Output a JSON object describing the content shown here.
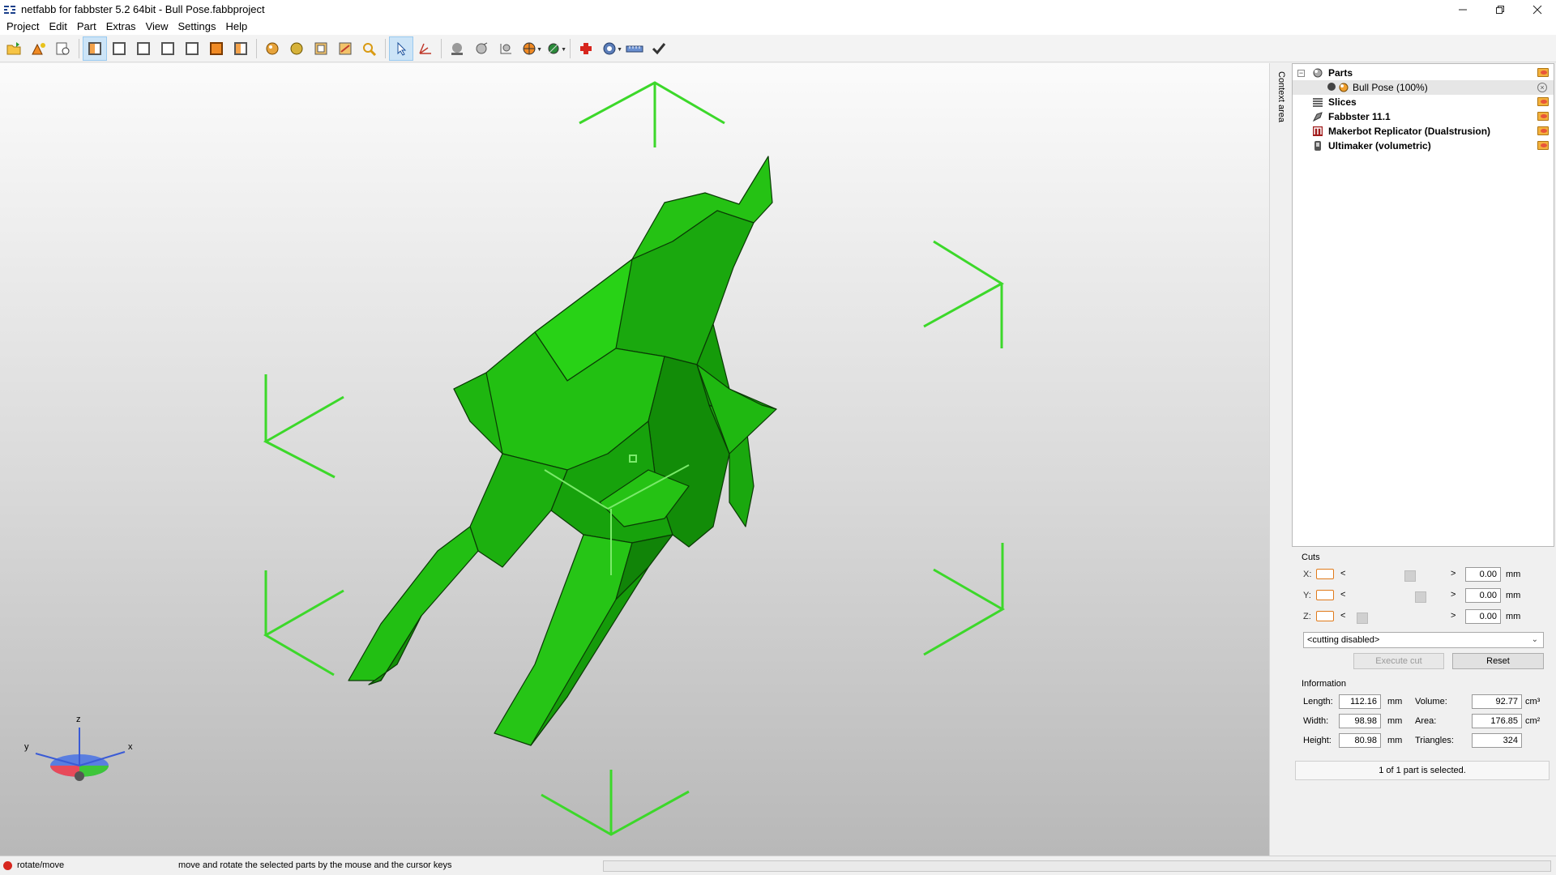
{
  "window": {
    "title": "netfabb for fabbster 5.2 64bit - Bull Pose.fabbproject",
    "controls": [
      "minimize",
      "restore",
      "close"
    ]
  },
  "menu": [
    "Project",
    "Edit",
    "Part",
    "Extras",
    "View",
    "Settings",
    "Help"
  ],
  "toolbar": {
    "icons": [
      "open-project-icon",
      "add-part-icon",
      "report-icon",
      "view-default-icon",
      "view-front-icon",
      "view-back-icon",
      "view-left-icon",
      "view-right-icon",
      "view-top-icon",
      "view-bottom-icon",
      "repair-icon",
      "boolean-icon",
      "cut-icon",
      "measure-icon",
      "zoom-icon",
      "select-icon",
      "rotate-move-icon",
      "shading-icon",
      "sphere-icon",
      "axis-icon",
      "color-mode-icon",
      "display-options-icon",
      "add-icon",
      "settings-wheel-icon",
      "ruler-icon",
      "checkmark-icon"
    ]
  },
  "context_area_label": "Context area",
  "tree": {
    "items": [
      {
        "label": "Parts",
        "bold": true,
        "icon": "parts-icon"
      },
      {
        "label": "Bull Pose (100%)",
        "bold": false,
        "icon": "part-icon",
        "selected": true
      },
      {
        "label": "Slices",
        "bold": true,
        "icon": "slices-icon"
      },
      {
        "label": "Fabbster 11.1",
        "bold": true,
        "icon": "machine-icon"
      },
      {
        "label": "Makerbot Replicator (Dualstrusion)",
        "bold": true,
        "icon": "makerbot-icon"
      },
      {
        "label": "Ultimaker (volumetric)",
        "bold": true,
        "icon": "ultimaker-icon"
      }
    ]
  },
  "cuts": {
    "title": "Cuts",
    "rows": [
      {
        "axis": "X:",
        "value": "0.00",
        "unit": "mm"
      },
      {
        "axis": "Y:",
        "value": "0.00",
        "unit": "mm"
      },
      {
        "axis": "Z:",
        "value": "0.00",
        "unit": "mm"
      }
    ],
    "mode": "<cutting disabled>",
    "execute_label": "Execute cut",
    "reset_label": "Reset"
  },
  "information": {
    "title": "Information",
    "length_label": "Length:",
    "length": "112.16",
    "length_unit": "mm",
    "width_label": "Width:",
    "width": "98.98",
    "width_unit": "mm",
    "height_label": "Height:",
    "height": "80.98",
    "height_unit": "mm",
    "volume_label": "Volume:",
    "volume": "92.77",
    "volume_unit": "cm³",
    "area_label": "Area:",
    "area": "176.85",
    "area_unit": "cm²",
    "triangles_label": "Triangles:",
    "triangles": "324"
  },
  "selection_text": "1 of 1 part is selected.",
  "status": {
    "mode": "rotate/move",
    "message": "move and rotate the selected parts by the mouse and the cursor keys"
  },
  "axes": {
    "x": "x",
    "y": "y",
    "z": "z"
  },
  "colors": {
    "model": "#22cc11",
    "gizmo": "#33dd22"
  }
}
